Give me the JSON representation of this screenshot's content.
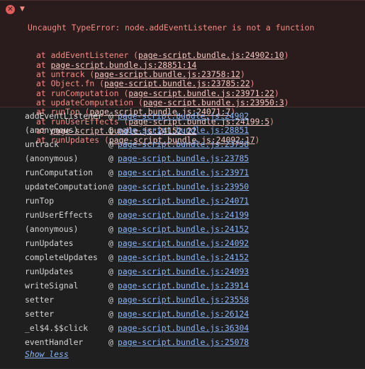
{
  "error": {
    "icon": "error-circle-icon",
    "caret": "expanded-caret-icon",
    "message": "Uncaught TypeError: node.addEventListener is not a function",
    "frames": [
      {
        "prefix": "at addEventListener (",
        "link": "page-script.bundle.js:24902:10",
        "suffix": ")"
      },
      {
        "prefix": "at ",
        "link": "page-script.bundle.js:28851:14",
        "suffix": ""
      },
      {
        "prefix": "at untrack (",
        "link": "page-script.bundle.js:23758:12",
        "suffix": ")"
      },
      {
        "prefix": "at Object.fn (",
        "link": "page-script.bundle.js:23785:22",
        "suffix": ")"
      },
      {
        "prefix": "at runComputation (",
        "link": "page-script.bundle.js:23971:22",
        "suffix": ")"
      },
      {
        "prefix": "at updateComputation (",
        "link": "page-script.bundle.js:23950:3",
        "suffix": ")"
      },
      {
        "prefix": "at runTop (",
        "link": "page-script.bundle.js:24071:7",
        "suffix": ")"
      },
      {
        "prefix": "at runUserEffects (",
        "link": "page-script.bundle.js:24199:5",
        "suffix": ")"
      },
      {
        "prefix": "at ",
        "link": "page-script.bundle.js:24152:22",
        "suffix": ""
      },
      {
        "prefix": "at runUpdates (",
        "link": "page-script.bundle.js:24092:17",
        "suffix": ")"
      }
    ]
  },
  "stack": [
    {
      "fn": "addEventListener",
      "at": "@",
      "src": "page-script.bundle.js:24902"
    },
    {
      "fn": "(anonymous)",
      "at": "@",
      "src": "page-script.bundle.js:28851"
    },
    {
      "fn": "untrack",
      "at": "@",
      "src": "page-script.bundle.js:23758"
    },
    {
      "fn": "(anonymous)",
      "at": "@",
      "src": "page-script.bundle.js:23785"
    },
    {
      "fn": "runComputation",
      "at": "@",
      "src": "page-script.bundle.js:23971"
    },
    {
      "fn": "updateComputation",
      "at": "@",
      "src": "page-script.bundle.js:23950"
    },
    {
      "fn": "runTop",
      "at": "@",
      "src": "page-script.bundle.js:24071"
    },
    {
      "fn": "runUserEffects",
      "at": "@",
      "src": "page-script.bundle.js:24199"
    },
    {
      "fn": "(anonymous)",
      "at": "@",
      "src": "page-script.bundle.js:24152"
    },
    {
      "fn": "runUpdates",
      "at": "@",
      "src": "page-script.bundle.js:24092"
    },
    {
      "fn": "completeUpdates",
      "at": "@",
      "src": "page-script.bundle.js:24152"
    },
    {
      "fn": "runUpdates",
      "at": "@",
      "src": "page-script.bundle.js:24093"
    },
    {
      "fn": "writeSignal",
      "at": "@",
      "src": "page-script.bundle.js:23914"
    },
    {
      "fn": "setter",
      "at": "@",
      "src": "page-script.bundle.js:23558"
    },
    {
      "fn": "setter",
      "at": "@",
      "src": "page-script.bundle.js:26124"
    },
    {
      "fn": "_el$4.$$click",
      "at": "@",
      "src": "page-script.bundle.js:36304"
    },
    {
      "fn": "eventHandler",
      "at": "@",
      "src": "page-script.bundle.js:25078"
    }
  ],
  "show_less": "Show less"
}
